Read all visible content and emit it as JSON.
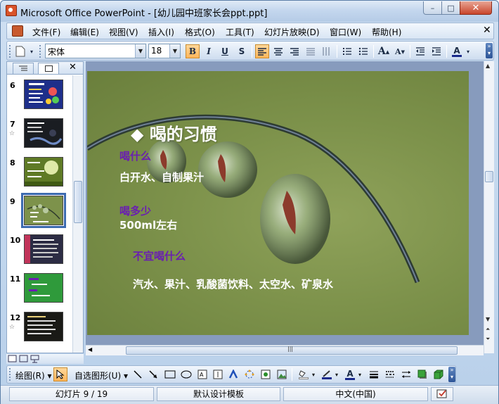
{
  "window": {
    "title": "Microsoft Office PowerPoint - [幼儿园中班家长会ppt.ppt]",
    "minimize": "–",
    "maximize": "□",
    "close": "✕"
  },
  "menubar": {
    "items": [
      {
        "label": "文件(F)"
      },
      {
        "label": "编辑(E)"
      },
      {
        "label": "视图(V)"
      },
      {
        "label": "插入(I)"
      },
      {
        "label": "格式(O)"
      },
      {
        "label": "工具(T)"
      },
      {
        "label": "幻灯片放映(D)"
      },
      {
        "label": "窗口(W)"
      },
      {
        "label": "帮助(H)"
      }
    ],
    "close": "✕"
  },
  "toolbar": {
    "font": "宋体",
    "size": "18",
    "bold": "B",
    "italic": "I",
    "underline": "U",
    "shadow": "S",
    "grow_font": "A",
    "shrink_font": "A",
    "font_color": "A"
  },
  "slide_panel": {
    "close": "✕",
    "slides": [
      {
        "num": "6",
        "starred": false
      },
      {
        "num": "7",
        "starred": true
      },
      {
        "num": "8",
        "starred": false
      },
      {
        "num": "9",
        "starred": false,
        "selected": true
      },
      {
        "num": "10",
        "starred": false
      },
      {
        "num": "11",
        "starred": false
      },
      {
        "num": "12",
        "starred": true
      }
    ],
    "star": "☆"
  },
  "slide": {
    "title": "◆ 喝的习惯",
    "q1": "喝什么",
    "a1": "白开水、自制果汁",
    "q2": "喝多少",
    "a2": "500ml左右",
    "q3": "不宜喝什么",
    "a3": "汽水、果汁、乳酸菌饮料、太空水、矿泉水"
  },
  "drawbar": {
    "draw_label": "绘图(R)",
    "autoshapes_label": "自选图形(U)"
  },
  "statusbar": {
    "slide_info": "幻灯片 9 / 19",
    "template": "默认设计模板",
    "language": "中文(中国)"
  },
  "colors": {
    "slide_bg": "#7d924b",
    "question_text": "#6a1fb0",
    "answer_text": "#ffffff",
    "selection_outline": "#3c6ab0"
  }
}
